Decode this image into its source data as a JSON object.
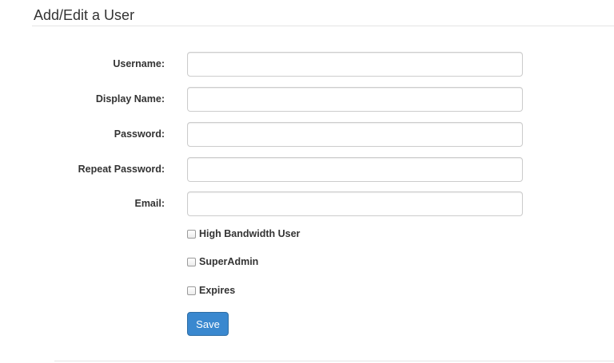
{
  "page": {
    "title": "Add/Edit a User"
  },
  "form": {
    "fields": [
      {
        "label": "Username:",
        "value": "",
        "placeholder": ""
      },
      {
        "label": "Display Name:",
        "value": "",
        "placeholder": ""
      },
      {
        "label": "Password:",
        "value": "",
        "placeholder": ""
      },
      {
        "label": "Repeat Password:",
        "value": "",
        "placeholder": ""
      },
      {
        "label": "Email:",
        "value": "",
        "placeholder": ""
      }
    ],
    "checkboxes": [
      {
        "label": "High Bandwidth User",
        "checked": false
      },
      {
        "label": "SuperAdmin",
        "checked": false
      },
      {
        "label": "Expires",
        "checked": false
      }
    ],
    "save_label": "Save"
  },
  "colors": {
    "primary_button": "#3a88cf",
    "input_border": "#cccccc",
    "text": "#333333"
  }
}
